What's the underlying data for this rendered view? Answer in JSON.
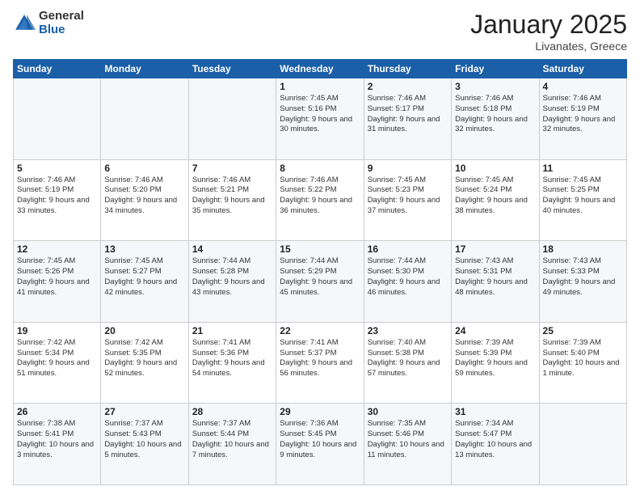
{
  "header": {
    "logo_general": "General",
    "logo_blue": "Blue",
    "month_title": "January 2025",
    "location": "Livanates, Greece"
  },
  "days_of_week": [
    "Sunday",
    "Monday",
    "Tuesday",
    "Wednesday",
    "Thursday",
    "Friday",
    "Saturday"
  ],
  "weeks": [
    [
      {
        "day": "",
        "info": ""
      },
      {
        "day": "",
        "info": ""
      },
      {
        "day": "",
        "info": ""
      },
      {
        "day": "1",
        "info": "Sunrise: 7:45 AM\nSunset: 5:16 PM\nDaylight: 9 hours\nand 30 minutes."
      },
      {
        "day": "2",
        "info": "Sunrise: 7:46 AM\nSunset: 5:17 PM\nDaylight: 9 hours\nand 31 minutes."
      },
      {
        "day": "3",
        "info": "Sunrise: 7:46 AM\nSunset: 5:18 PM\nDaylight: 9 hours\nand 32 minutes."
      },
      {
        "day": "4",
        "info": "Sunrise: 7:46 AM\nSunset: 5:19 PM\nDaylight: 9 hours\nand 32 minutes."
      }
    ],
    [
      {
        "day": "5",
        "info": "Sunrise: 7:46 AM\nSunset: 5:19 PM\nDaylight: 9 hours\nand 33 minutes."
      },
      {
        "day": "6",
        "info": "Sunrise: 7:46 AM\nSunset: 5:20 PM\nDaylight: 9 hours\nand 34 minutes."
      },
      {
        "day": "7",
        "info": "Sunrise: 7:46 AM\nSunset: 5:21 PM\nDaylight: 9 hours\nand 35 minutes."
      },
      {
        "day": "8",
        "info": "Sunrise: 7:46 AM\nSunset: 5:22 PM\nDaylight: 9 hours\nand 36 minutes."
      },
      {
        "day": "9",
        "info": "Sunrise: 7:45 AM\nSunset: 5:23 PM\nDaylight: 9 hours\nand 37 minutes."
      },
      {
        "day": "10",
        "info": "Sunrise: 7:45 AM\nSunset: 5:24 PM\nDaylight: 9 hours\nand 38 minutes."
      },
      {
        "day": "11",
        "info": "Sunrise: 7:45 AM\nSunset: 5:25 PM\nDaylight: 9 hours\nand 40 minutes."
      }
    ],
    [
      {
        "day": "12",
        "info": "Sunrise: 7:45 AM\nSunset: 5:26 PM\nDaylight: 9 hours\nand 41 minutes."
      },
      {
        "day": "13",
        "info": "Sunrise: 7:45 AM\nSunset: 5:27 PM\nDaylight: 9 hours\nand 42 minutes."
      },
      {
        "day": "14",
        "info": "Sunrise: 7:44 AM\nSunset: 5:28 PM\nDaylight: 9 hours\nand 43 minutes."
      },
      {
        "day": "15",
        "info": "Sunrise: 7:44 AM\nSunset: 5:29 PM\nDaylight: 9 hours\nand 45 minutes."
      },
      {
        "day": "16",
        "info": "Sunrise: 7:44 AM\nSunset: 5:30 PM\nDaylight: 9 hours\nand 46 minutes."
      },
      {
        "day": "17",
        "info": "Sunrise: 7:43 AM\nSunset: 5:31 PM\nDaylight: 9 hours\nand 48 minutes."
      },
      {
        "day": "18",
        "info": "Sunrise: 7:43 AM\nSunset: 5:33 PM\nDaylight: 9 hours\nand 49 minutes."
      }
    ],
    [
      {
        "day": "19",
        "info": "Sunrise: 7:42 AM\nSunset: 5:34 PM\nDaylight: 9 hours\nand 51 minutes."
      },
      {
        "day": "20",
        "info": "Sunrise: 7:42 AM\nSunset: 5:35 PM\nDaylight: 9 hours\nand 52 minutes."
      },
      {
        "day": "21",
        "info": "Sunrise: 7:41 AM\nSunset: 5:36 PM\nDaylight: 9 hours\nand 54 minutes."
      },
      {
        "day": "22",
        "info": "Sunrise: 7:41 AM\nSunset: 5:37 PM\nDaylight: 9 hours\nand 56 minutes."
      },
      {
        "day": "23",
        "info": "Sunrise: 7:40 AM\nSunset: 5:38 PM\nDaylight: 9 hours\nand 57 minutes."
      },
      {
        "day": "24",
        "info": "Sunrise: 7:39 AM\nSunset: 5:39 PM\nDaylight: 9 hours\nand 59 minutes."
      },
      {
        "day": "25",
        "info": "Sunrise: 7:39 AM\nSunset: 5:40 PM\nDaylight: 10 hours\nand 1 minute."
      }
    ],
    [
      {
        "day": "26",
        "info": "Sunrise: 7:38 AM\nSunset: 5:41 PM\nDaylight: 10 hours\nand 3 minutes."
      },
      {
        "day": "27",
        "info": "Sunrise: 7:37 AM\nSunset: 5:43 PM\nDaylight: 10 hours\nand 5 minutes."
      },
      {
        "day": "28",
        "info": "Sunrise: 7:37 AM\nSunset: 5:44 PM\nDaylight: 10 hours\nand 7 minutes."
      },
      {
        "day": "29",
        "info": "Sunrise: 7:36 AM\nSunset: 5:45 PM\nDaylight: 10 hours\nand 9 minutes."
      },
      {
        "day": "30",
        "info": "Sunrise: 7:35 AM\nSunset: 5:46 PM\nDaylight: 10 hours\nand 11 minutes."
      },
      {
        "day": "31",
        "info": "Sunrise: 7:34 AM\nSunset: 5:47 PM\nDaylight: 10 hours\nand 13 minutes."
      },
      {
        "day": "",
        "info": ""
      }
    ]
  ]
}
